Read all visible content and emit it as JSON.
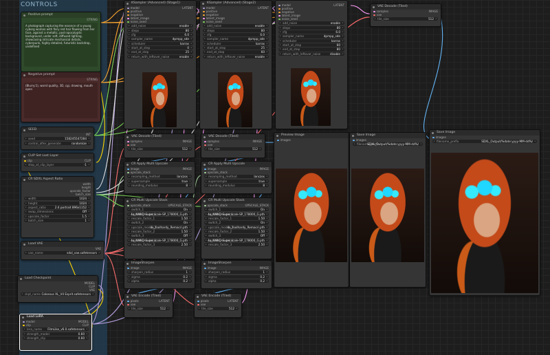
{
  "group": {
    "title": "CONTROLS"
  },
  "positive": {
    "title": "Positive prompt",
    "output": "STRING",
    "text": "A photograph capturing the essence of a young cyborg woman with fiery red hair flowing from her face, against a metallic, post-apocalyptic background, under soft, diffused lighting, showcasing intricate mechanical details, cyberpunk, highly detailed, futuristic backdrop, undefined"
  },
  "negative": {
    "title": "Negative prompt",
    "output": "STRING",
    "text": "(Blurry:1), worst quality, 3D, cgi, drawing, mouth open"
  },
  "seed": {
    "title": "SEED",
    "output": "INT",
    "label1": "seed",
    "value1": "158245547284",
    "label2": "control_after_generate",
    "value2": "randomize"
  },
  "clip_last": {
    "title": "CLIP Set Last Layer",
    "in": "clip",
    "out": "CLIP",
    "label": "stop_at_clip_layer",
    "value": "-1"
  },
  "aspect": {
    "title": "CR SDXL Aspect Ratio",
    "outs": [
      "width",
      "height",
      "upscale_factor",
      "batch_size"
    ],
    "widgets": [
      {
        "label": "width",
        "value": "1024"
      },
      {
        "label": "height",
        "value": "1024"
      },
      {
        "label": "aspect_ratio",
        "value": "2:4 portrait 896x1152"
      },
      {
        "label": "swap_dimensions",
        "value": "Off"
      },
      {
        "label": "upscale_factor",
        "value": "1.5"
      },
      {
        "label": "batch_size",
        "value": "1"
      }
    ]
  },
  "vae_loader": {
    "title": "Load VAE",
    "out": "VAE",
    "label": "vae_name",
    "value": "sdxl_vae.safetensors"
  },
  "checkpoint": {
    "title": "Load Checkpoint",
    "outs": [
      "MODEL",
      "CLIP",
      "VAE"
    ],
    "label": "ckpt_name",
    "value": "Colossus XL_V4 Esprit.safetensors"
  },
  "lora": {
    "title": "Load LoRA",
    "ins": [
      "model",
      "clip"
    ],
    "outs": [
      "MODEL",
      "CLIP"
    ],
    "widgets": [
      {
        "label": "lora_name",
        "value": "FilmLike_v6.0.safetensors"
      },
      {
        "label": "strength_model",
        "value": "0.60"
      },
      {
        "label": "strength_clip",
        "value": "0.60"
      }
    ]
  },
  "ksampler1": {
    "title": "KSampler (Advanced) (Stage1)",
    "ins": [
      "model",
      "positive",
      "negative",
      "latent_image",
      "noise_seed"
    ],
    "out": "LATENT",
    "widgets": [
      {
        "label": "add_noise",
        "value": "enable"
      },
      {
        "label": "steps",
        "value": "80"
      },
      {
        "label": "cfg",
        "value": "6.0"
      },
      {
        "label": "sampler_name",
        "value": "dpmpp_sde"
      },
      {
        "label": "scheduler",
        "value": "karras"
      },
      {
        "label": "start_at_step",
        "value": "0"
      },
      {
        "label": "end_at_step",
        "value": "25"
      },
      {
        "label": "return_with_leftover_noise",
        "value": "enable"
      }
    ]
  },
  "ksampler2": {
    "title": "KSampler (Advanced) (Stage2)",
    "ins": [
      "model",
      "positive",
      "negative",
      "latent_image",
      "noise_seed"
    ],
    "out": "LATENT",
    "widgets": [
      {
        "label": "add_noise",
        "value": "enable"
      },
      {
        "label": "steps",
        "value": "80"
      },
      {
        "label": "cfg",
        "value": "6.0"
      },
      {
        "label": "sampler_name",
        "value": "dpmpp_sde"
      },
      {
        "label": "scheduler",
        "value": "karras"
      },
      {
        "label": "start_at_step",
        "value": "25"
      },
      {
        "label": "end_at_step",
        "value": "60"
      },
      {
        "label": "return_with_leftover_noise",
        "value": "enable"
      }
    ]
  },
  "ksampler3": {
    "ins": [
      "model",
      "positive",
      "negative",
      "latent_image",
      "noise_seed"
    ],
    "out": "LATENT",
    "widgets": [
      {
        "label": "add_noise",
        "value": "enable"
      },
      {
        "label": "steps",
        "value": "80"
      },
      {
        "label": "cfg",
        "value": "6.0"
      },
      {
        "label": "sampler_name",
        "value": "dpmpp_sde"
      },
      {
        "label": "scheduler",
        "value": "karras"
      },
      {
        "label": "start_at_step",
        "value": "60"
      },
      {
        "label": "end_at_step",
        "value": "80"
      },
      {
        "label": "return_with_leftover_noise",
        "value": "disable"
      }
    ]
  },
  "vae_decode_top": {
    "title": "VAE Decode (Tiled)",
    "ins": [
      "samples",
      "vae"
    ],
    "out": "IMAGE",
    "label": "tile_size",
    "value": "512"
  },
  "vae_decode1": {
    "title": "VAE Decode (Tiled)",
    "ins": [
      "samples",
      "vae"
    ],
    "out": "IMAGE",
    "label": "tile_size",
    "value": "512"
  },
  "vae_decode2": {
    "title": "VAE Decode (Tiled)",
    "ins": [
      "samples",
      "vae"
    ],
    "out": "IMAGE",
    "label": "tile_size",
    "value": "512"
  },
  "upscale1": {
    "title": "CR Apply Multi Upscale",
    "ins": [
      "image",
      "upscale_stack"
    ],
    "out": "IMAGE",
    "widgets": [
      {
        "label": "resampling_method",
        "value": "lanczos"
      },
      {
        "label": "supersample",
        "value": "true"
      },
      {
        "label": "rounding_modulus",
        "value": "8"
      }
    ]
  },
  "upscale2": {
    "title": "CR Apply Multi Upscale",
    "ins": [
      "image",
      "upscale_stack"
    ],
    "out": "IMAGE",
    "widgets": [
      {
        "label": "resampling_method",
        "value": "lanczos"
      },
      {
        "label": "supersample",
        "value": "true"
      },
      {
        "label": "rounding_modulus",
        "value": "8"
      }
    ]
  },
  "stack1": {
    "title": "CR Multi Upscale Stack",
    "in": "upscale_stack",
    "out": "UPSCALE_STACK",
    "widgets": [
      {
        "label": "switch_1",
        "value": "On"
      },
      {
        "label": "upscale_model_1",
        "value": "4x_NMKD-Superscale-SP_178000_G.pth"
      },
      {
        "label": "rescale_factor_1",
        "value": "1.50"
      },
      {
        "label": "switch_2",
        "value": "On"
      },
      {
        "label": "upscale_model_2",
        "value": "4x_foolhardy_Remacri.pth"
      },
      {
        "label": "rescale_factor_2",
        "value": "1.50"
      },
      {
        "label": "switch_3",
        "value": "Off"
      },
      {
        "label": "upscale_model_3",
        "value": "4x_NMKD-Superscale-SP_178000_G.pth"
      },
      {
        "label": "rescale_factor_3",
        "value": "2.50"
      }
    ]
  },
  "stack2": {
    "title": "CR Multi Upscale Stack",
    "in": "upscale_stack",
    "out": "UPSCALE_STACK",
    "widgets": [
      {
        "label": "switch_1",
        "value": "On"
      },
      {
        "label": "upscale_model_1",
        "value": "4x_NMKD-Superscale-SP_178000_G.pth"
      },
      {
        "label": "rescale_factor_1",
        "value": "1.50"
      },
      {
        "label": "switch_2",
        "value": "On"
      },
      {
        "label": "upscale_model_2",
        "value": "4x_foolhardy_Remacri.pth"
      },
      {
        "label": "rescale_factor_2",
        "value": "1.50"
      },
      {
        "label": "switch_3",
        "value": "Off"
      },
      {
        "label": "upscale_model_3",
        "value": "4x_NMKD-Superscale-SP_178000_G.pth"
      },
      {
        "label": "rescale_factor_3",
        "value": "2.50"
      }
    ]
  },
  "sharpen1": {
    "title": "ImageSharpen",
    "in": "image",
    "out": "IMAGE",
    "widgets": [
      {
        "label": "sharpen_radius",
        "value": "1"
      },
      {
        "label": "sigma",
        "value": "0.2"
      },
      {
        "label": "alpha",
        "value": "0.2"
      }
    ]
  },
  "sharpen2": {
    "title": "ImageSharpen",
    "in": "image",
    "out": "IMAGE",
    "widgets": [
      {
        "label": "sharpen_radius",
        "value": "1"
      },
      {
        "label": "sigma",
        "value": "0.2"
      },
      {
        "label": "alpha",
        "value": "0.2"
      }
    ]
  },
  "encode1": {
    "title": "VAE Encode (Tiled)",
    "ins": [
      "pixels",
      "vae"
    ],
    "out": "LATENT",
    "label": "tile_size",
    "value": "512"
  },
  "encode2": {
    "title": "VAE Encode (Tiled)",
    "ins": [
      "pixels",
      "vae"
    ],
    "out": "LATENT",
    "label": "tile_size",
    "value": "512"
  },
  "preview": {
    "title": "Preview Image",
    "in": "images"
  },
  "save1": {
    "title": "Save Image",
    "in": "images",
    "label": "filename_prefix",
    "value": "SDXL_Output/%date:yyyy-MM-dd%/"
  },
  "save2": {
    "title": "Save Image",
    "in": "images",
    "label": "filename_prefix",
    "value": "SDXL_Output/%date:yyyy-MM-dd%/"
  },
  "colors": {
    "latent": "#ff9cf9",
    "model": "#b39ddb",
    "clip": "#ffd500",
    "vae": "#ff6e6e",
    "image": "#64b5f6",
    "conditioning": "#ffa931",
    "int": "#7ed957",
    "string": "#e8e8e8",
    "upscale": "#a9d6a0"
  }
}
